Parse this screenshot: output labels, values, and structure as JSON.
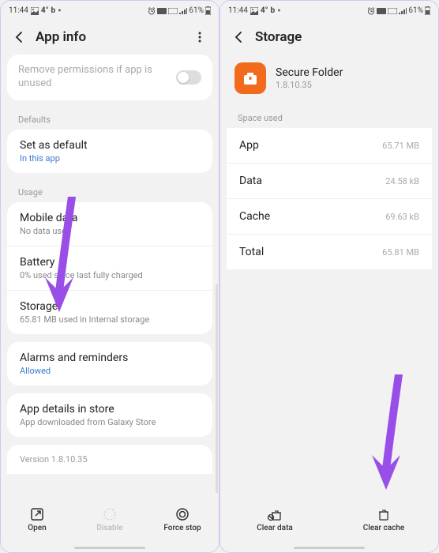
{
  "status": {
    "time": "11:44",
    "battery": "61%",
    "temp": "4°",
    "brand": "b"
  },
  "left": {
    "title": "App info",
    "perm_text": "Remove permissions if app is unused",
    "sec_defaults": "Defaults",
    "set_default": "Set as default",
    "set_default_sub": "In this app",
    "sec_usage": "Usage",
    "mobile_data": "Mobile data",
    "mobile_data_sub": "No data used",
    "battery": "Battery",
    "battery_sub": "0% used since last fully charged",
    "storage": "Storage",
    "storage_sub": "65.81 MB used in Internal storage",
    "alarms": "Alarms and reminders",
    "alarms_sub": "Allowed",
    "details": "App details in store",
    "details_sub": "App downloaded from Galaxy Store",
    "version": "Version 1.8.10.35",
    "btn_open": "Open",
    "btn_disable": "Disable",
    "btn_force": "Force stop"
  },
  "right": {
    "title": "Storage",
    "app_name": "Secure Folder",
    "app_version": "1.8.10.35",
    "sec_space": "Space used",
    "rows": {
      "app_l": "App",
      "app_v": "65.71 MB",
      "data_l": "Data",
      "data_v": "24.58 kB",
      "cache_l": "Cache",
      "cache_v": "69.63 kB",
      "total_l": "Total",
      "total_v": "65.81 MB"
    },
    "btn_clear_data": "Clear data",
    "btn_clear_cache": "Clear cache"
  }
}
